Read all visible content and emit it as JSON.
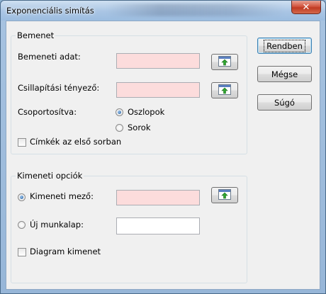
{
  "window": {
    "title": "Exponenciális simítás",
    "close_label": "✕"
  },
  "colors": {
    "ref_field": "#fcdcdc",
    "window_frame": "#a6c2e0",
    "client_bg": "#f0f0f0"
  },
  "input_group": {
    "legend": "Bemenet",
    "input_range_label": "Bemeneti adat:",
    "input_range_value": "",
    "damping_label": "Csillapítási tényező:",
    "damping_value": "",
    "grouped_by_label": "Csoportosítva:",
    "grouped_options": [
      {
        "label": "Oszlopok",
        "selected": true
      },
      {
        "label": "Sorok",
        "selected": false
      }
    ],
    "labels_first_row_label": "Címkék az első sorban",
    "labels_first_row_checked": false
  },
  "output_group": {
    "legend": "Kimeneti opciók",
    "output_range_label": "Kimeneti mező:",
    "output_range_selected": true,
    "output_range_value": "",
    "new_sheet_label": "Új munkalap:",
    "new_sheet_selected": false,
    "new_sheet_value": "",
    "chart_output_label": "Diagram kimenet",
    "chart_output_checked": false
  },
  "buttons": {
    "ok": "Rendben",
    "cancel": "Mégse",
    "help": "Súgó"
  },
  "icons": {
    "range_picker": "range-collapse-icon"
  }
}
